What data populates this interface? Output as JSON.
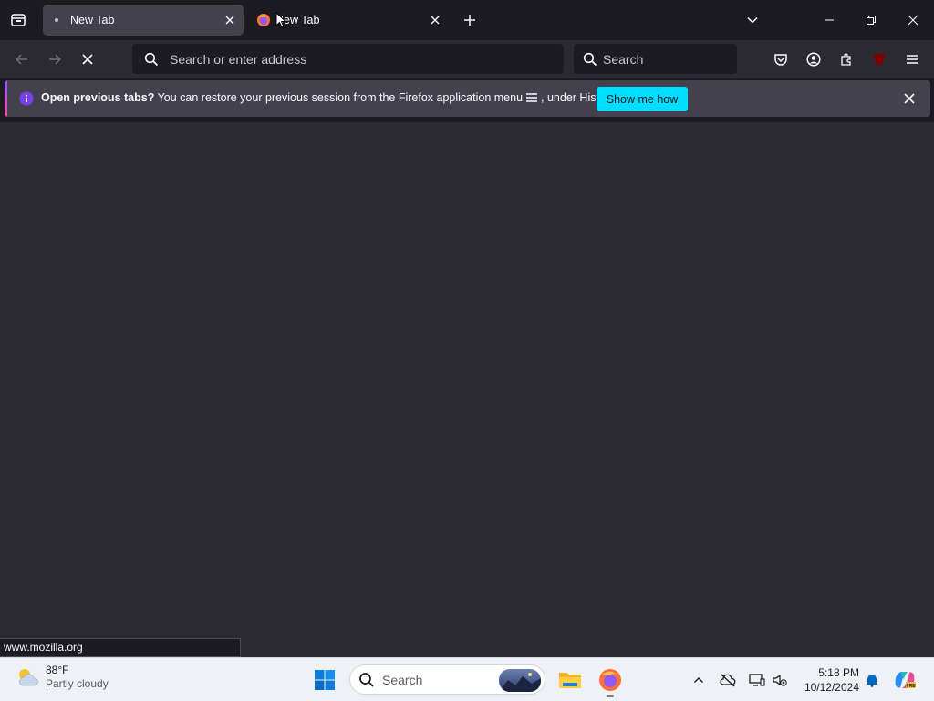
{
  "browser": {
    "tabs": [
      {
        "title": "New Tab",
        "active": true
      },
      {
        "title": "New Tab",
        "active": false
      }
    ],
    "urlbar": {
      "placeholder": "Search or enter address"
    },
    "searchbar": {
      "placeholder": "Search"
    },
    "extension_badge": "uO"
  },
  "notification": {
    "bold_text": "Open previous tabs?",
    "text_before_icon": " You can restore your previous session from the Firefox application menu",
    "text_after_icon": ", under History.",
    "button_label": "Show me how"
  },
  "status": {
    "url": "www.mozilla.org"
  },
  "taskbar": {
    "weather": {
      "temp": "88°F",
      "condition": "Partly cloudy"
    },
    "search_label": "Search",
    "clock": {
      "time": "5:18 PM",
      "date": "10/12/2024"
    }
  },
  "colors": {
    "accent": "#00ddff",
    "chrome": "#1c1b22",
    "toolbar": "#2b2a33",
    "infobar": "#42414d"
  }
}
